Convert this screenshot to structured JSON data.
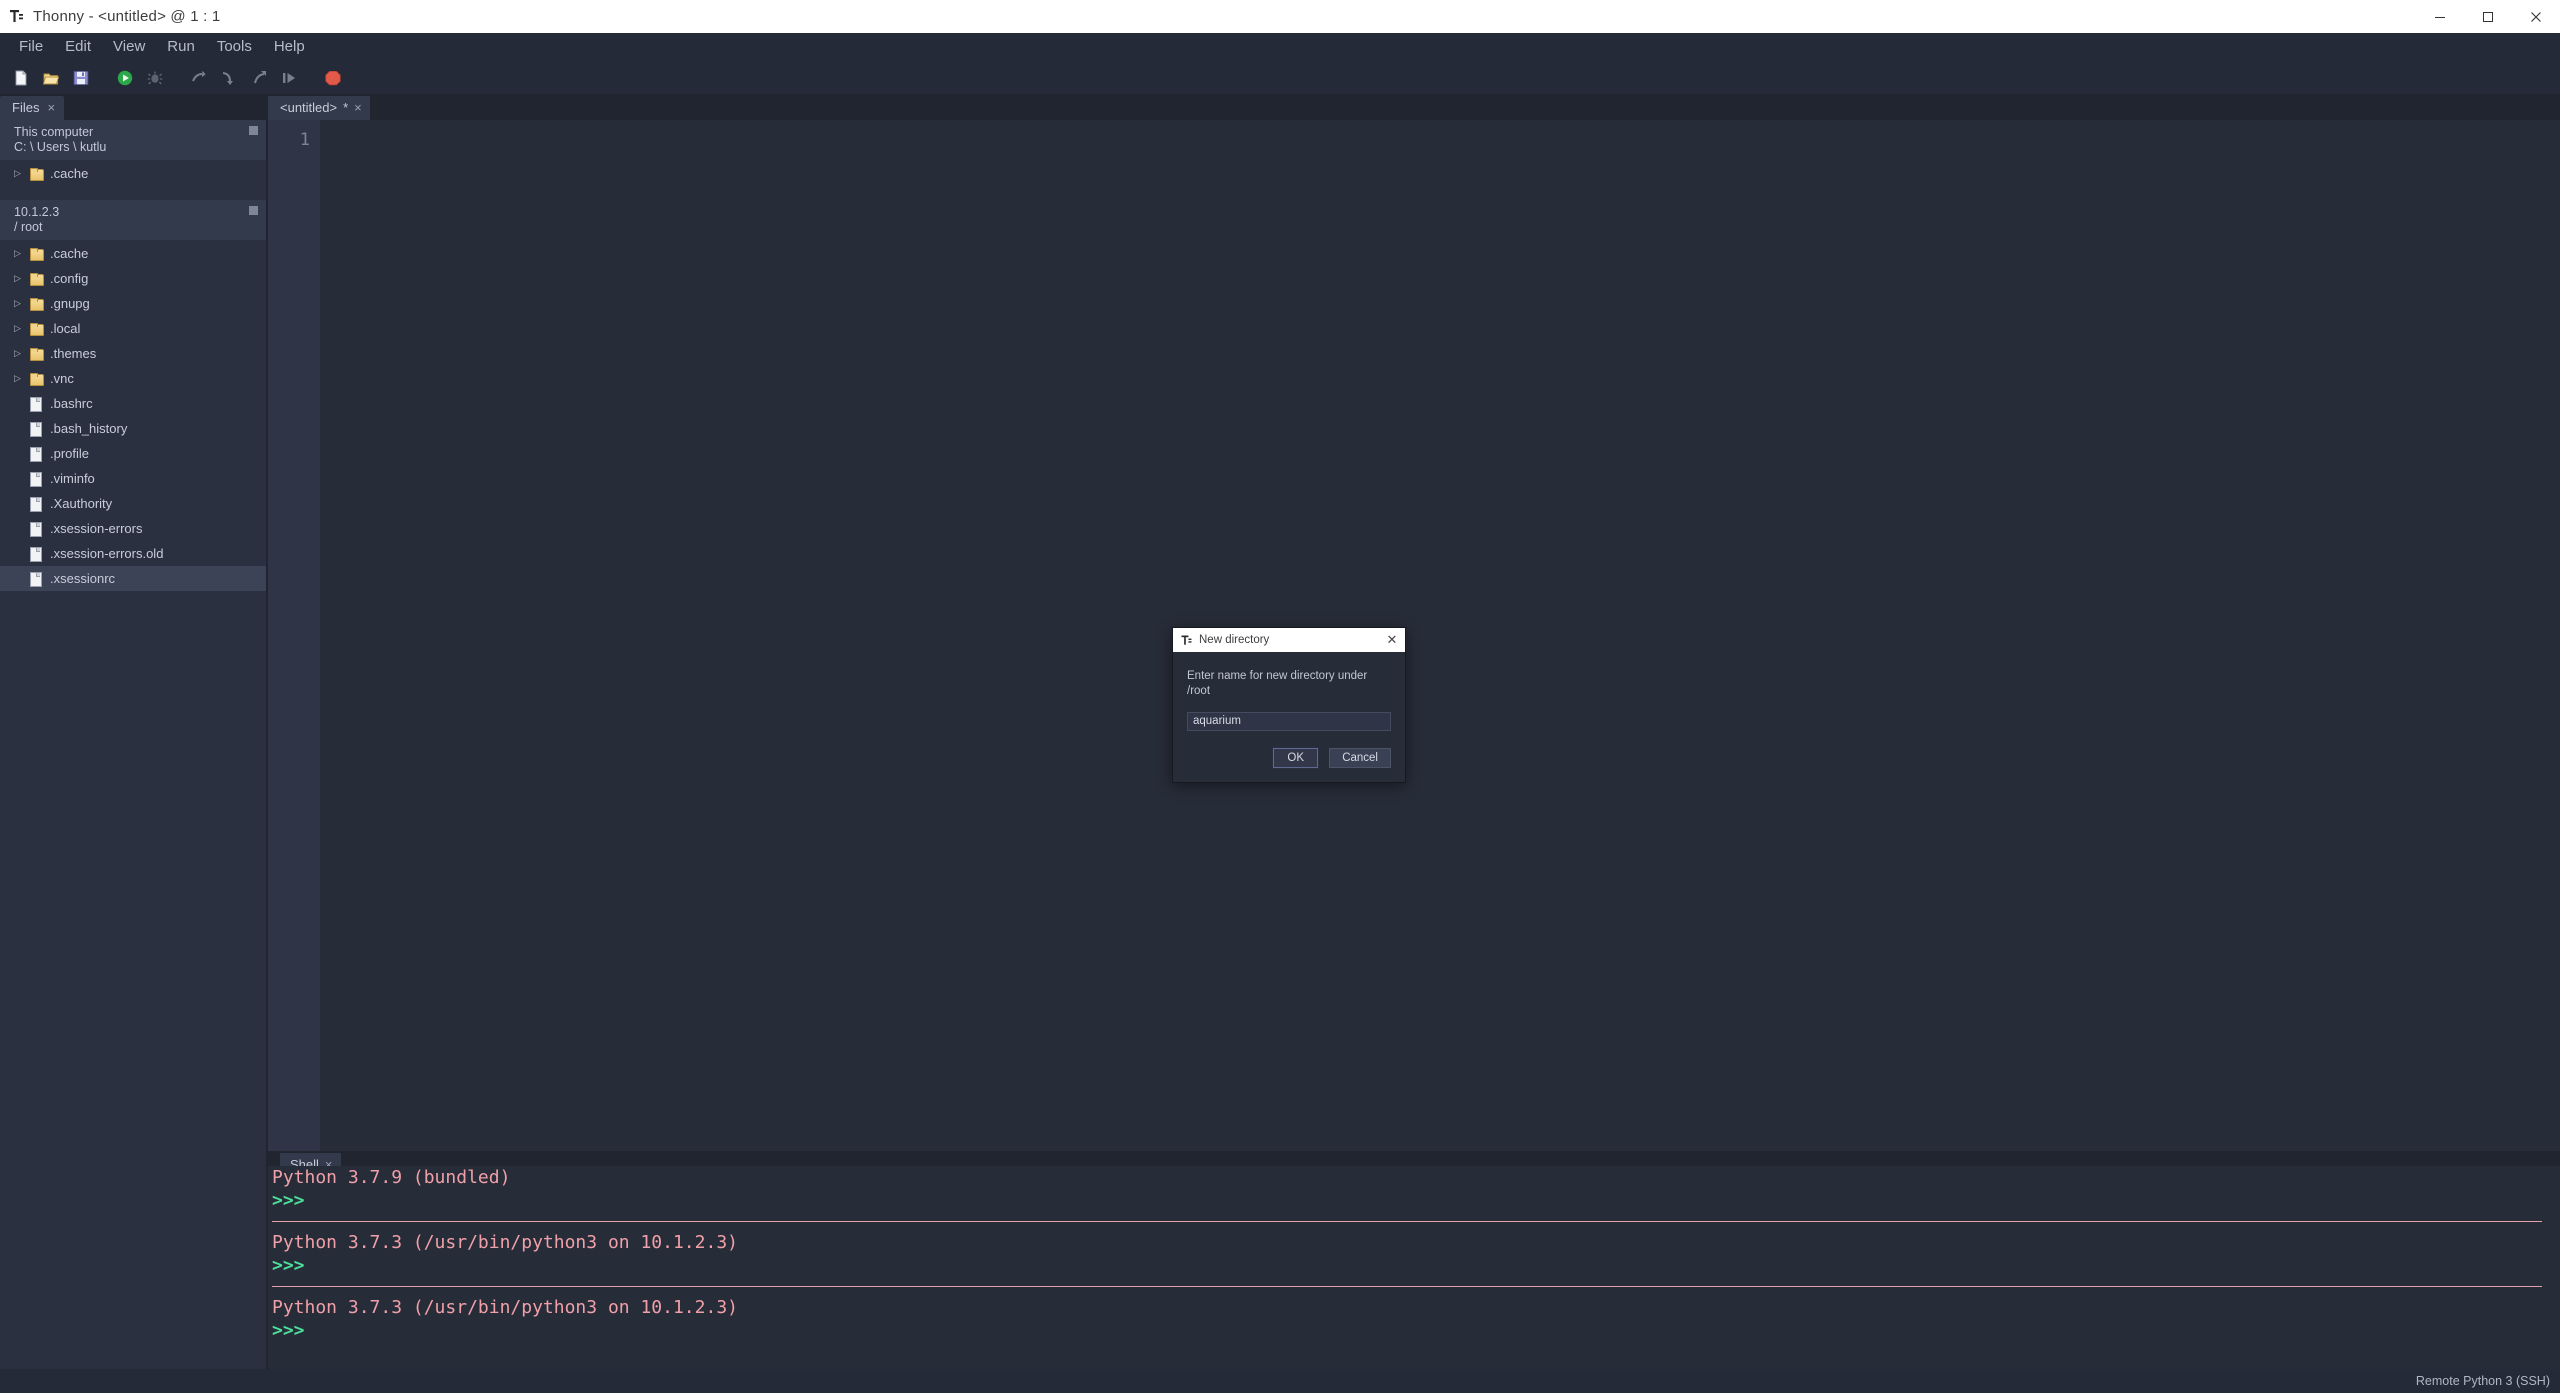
{
  "window": {
    "title": "Thonny  -  <untitled>  @  1 : 1",
    "app_icon": "thonny-icon",
    "minimize_label": "—",
    "maximize_label": "❐",
    "close_label": "✕"
  },
  "menubar": {
    "items": [
      {
        "label": "File",
        "name": "menu-file"
      },
      {
        "label": "Edit",
        "name": "menu-edit"
      },
      {
        "label": "View",
        "name": "menu-view"
      },
      {
        "label": "Run",
        "name": "menu-run"
      },
      {
        "label": "Tools",
        "name": "menu-tools"
      },
      {
        "label": "Help",
        "name": "menu-help"
      }
    ]
  },
  "toolbar": {
    "buttons": [
      {
        "name": "new-file-icon",
        "title": "New"
      },
      {
        "name": "open-file-icon",
        "title": "Load"
      },
      {
        "name": "save-file-icon",
        "title": "Save"
      },
      {
        "name": "run-icon",
        "title": "Run current script"
      },
      {
        "name": "debug-icon",
        "title": "Debug current script"
      },
      {
        "name": "step-over-icon",
        "title": "Step over"
      },
      {
        "name": "step-into-icon",
        "title": "Step into"
      },
      {
        "name": "step-out-icon",
        "title": "Step out"
      },
      {
        "name": "resume-icon",
        "title": "Resume"
      },
      {
        "name": "stop-icon",
        "title": "Stop/Restart backend"
      }
    ]
  },
  "sidebar": {
    "tab": {
      "label": "Files",
      "close": "×"
    },
    "local": {
      "title": "This computer",
      "path": "C: \\ Users \\ kutlu",
      "items": [
        {
          "label": ".cache",
          "type": "folder",
          "expandable": true,
          "selected": false
        }
      ]
    },
    "remote": {
      "title": "10.1.2.3",
      "path": "/ root",
      "items": [
        {
          "label": ".cache",
          "type": "folder",
          "expandable": true,
          "selected": false
        },
        {
          "label": ".config",
          "type": "folder",
          "expandable": true,
          "selected": false
        },
        {
          "label": ".gnupg",
          "type": "folder",
          "expandable": true,
          "selected": false
        },
        {
          "label": ".local",
          "type": "folder",
          "expandable": true,
          "selected": false
        },
        {
          "label": ".themes",
          "type": "folder",
          "expandable": true,
          "selected": false
        },
        {
          "label": ".vnc",
          "type": "folder",
          "expandable": true,
          "selected": false
        },
        {
          "label": ".bashrc",
          "type": "file",
          "expandable": false,
          "selected": false
        },
        {
          "label": ".bash_history",
          "type": "file",
          "expandable": false,
          "selected": false
        },
        {
          "label": ".profile",
          "type": "file",
          "expandable": false,
          "selected": false
        },
        {
          "label": ".viminfo",
          "type": "file",
          "expandable": false,
          "selected": false
        },
        {
          "label": ".Xauthority",
          "type": "file",
          "expandable": false,
          "selected": false
        },
        {
          "label": ".xsession-errors",
          "type": "file",
          "expandable": false,
          "selected": false
        },
        {
          "label": ".xsession-errors.old",
          "type": "file",
          "expandable": false,
          "selected": false
        },
        {
          "label": ".xsessionrc",
          "type": "file",
          "expandable": false,
          "selected": true
        }
      ]
    }
  },
  "editor": {
    "tab": {
      "label": "<untitled>",
      "modified": "*",
      "close": "×"
    },
    "line_numbers": [
      "1"
    ],
    "content": ""
  },
  "shell": {
    "tab": {
      "label": "Shell",
      "close": "×"
    },
    "lines": [
      {
        "type": "banner",
        "text": "Python 3.7.9 (bundled)"
      },
      {
        "type": "prompt",
        "text": ">>>"
      },
      {
        "type": "rule",
        "text": ""
      },
      {
        "type": "banner",
        "text": "Python 3.7.3 (/usr/bin/python3 on 10.1.2.3)"
      },
      {
        "type": "prompt",
        "text": ">>>"
      },
      {
        "type": "rule",
        "text": ""
      },
      {
        "type": "banner",
        "text": "Python 3.7.3 (/usr/bin/python3 on 10.1.2.3)"
      },
      {
        "type": "prompt",
        "text": ">>>"
      }
    ]
  },
  "statusbar": {
    "backend": "Remote Python 3 (SSH)"
  },
  "dialog": {
    "title": "New directory",
    "icon": "thonny-icon",
    "close": "✕",
    "message": "Enter name for new directory under /root",
    "input_value": "aquarium",
    "input_placeholder": "",
    "ok_label": "OK",
    "cancel_label": "Cancel"
  },
  "colors": {
    "window_bg": "#2b3040",
    "panel_bg": "#272c39",
    "tab_bg": "#333a4c",
    "accent_green": "#4ce09a",
    "banner_pink": "#f0a0a8",
    "folder_yellow": "#e8c36b"
  }
}
